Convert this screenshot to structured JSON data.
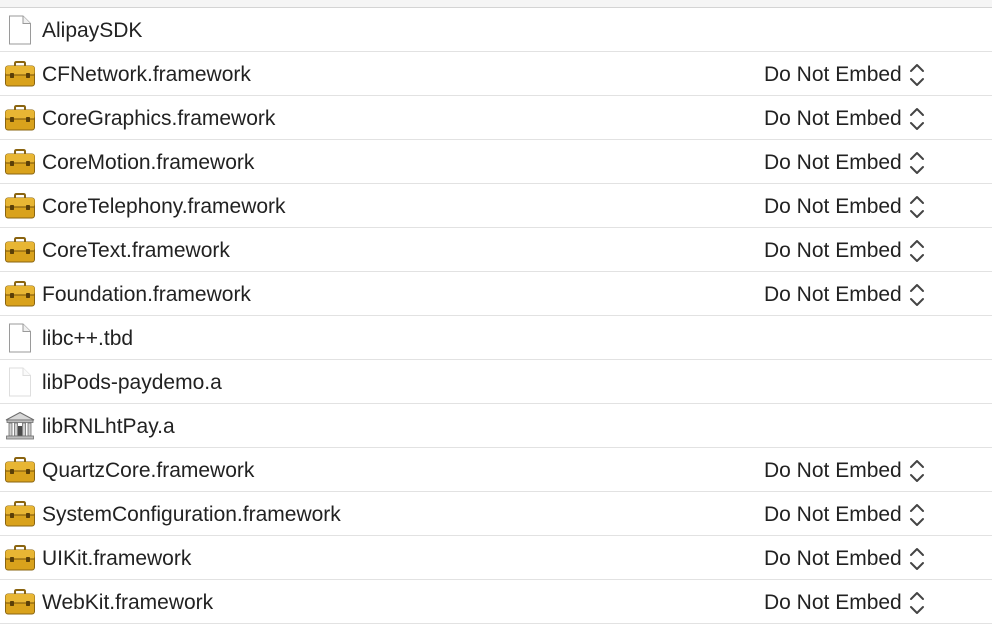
{
  "embed_label": "Do Not Embed",
  "rows": [
    {
      "name": "AlipaySDK",
      "icon": "document-icon",
      "embed": false
    },
    {
      "name": "CFNetwork.framework",
      "icon": "toolbox-icon",
      "embed": true
    },
    {
      "name": "CoreGraphics.framework",
      "icon": "toolbox-icon",
      "embed": true
    },
    {
      "name": "CoreMotion.framework",
      "icon": "toolbox-icon",
      "embed": true
    },
    {
      "name": "CoreTelephony.framework",
      "icon": "toolbox-icon",
      "embed": true
    },
    {
      "name": "CoreText.framework",
      "icon": "toolbox-icon",
      "embed": true
    },
    {
      "name": "Foundation.framework",
      "icon": "toolbox-icon",
      "embed": true
    },
    {
      "name": "libc++.tbd",
      "icon": "document-icon",
      "embed": false
    },
    {
      "name": "libPods-paydemo.a",
      "icon": "document-faint-icon",
      "embed": false
    },
    {
      "name": "libRNLhtPay.a",
      "icon": "library-icon",
      "embed": false
    },
    {
      "name": "QuartzCore.framework",
      "icon": "toolbox-icon",
      "embed": true
    },
    {
      "name": "SystemConfiguration.framework",
      "icon": "toolbox-icon",
      "embed": true
    },
    {
      "name": "UIKit.framework",
      "icon": "toolbox-icon",
      "embed": true
    },
    {
      "name": "WebKit.framework",
      "icon": "toolbox-icon",
      "embed": true
    }
  ],
  "colors": {
    "toolbox_body": "#d9a21c",
    "toolbox_dark": "#8a6410",
    "row_divider": "#e2e2e2",
    "text": "#222222"
  }
}
